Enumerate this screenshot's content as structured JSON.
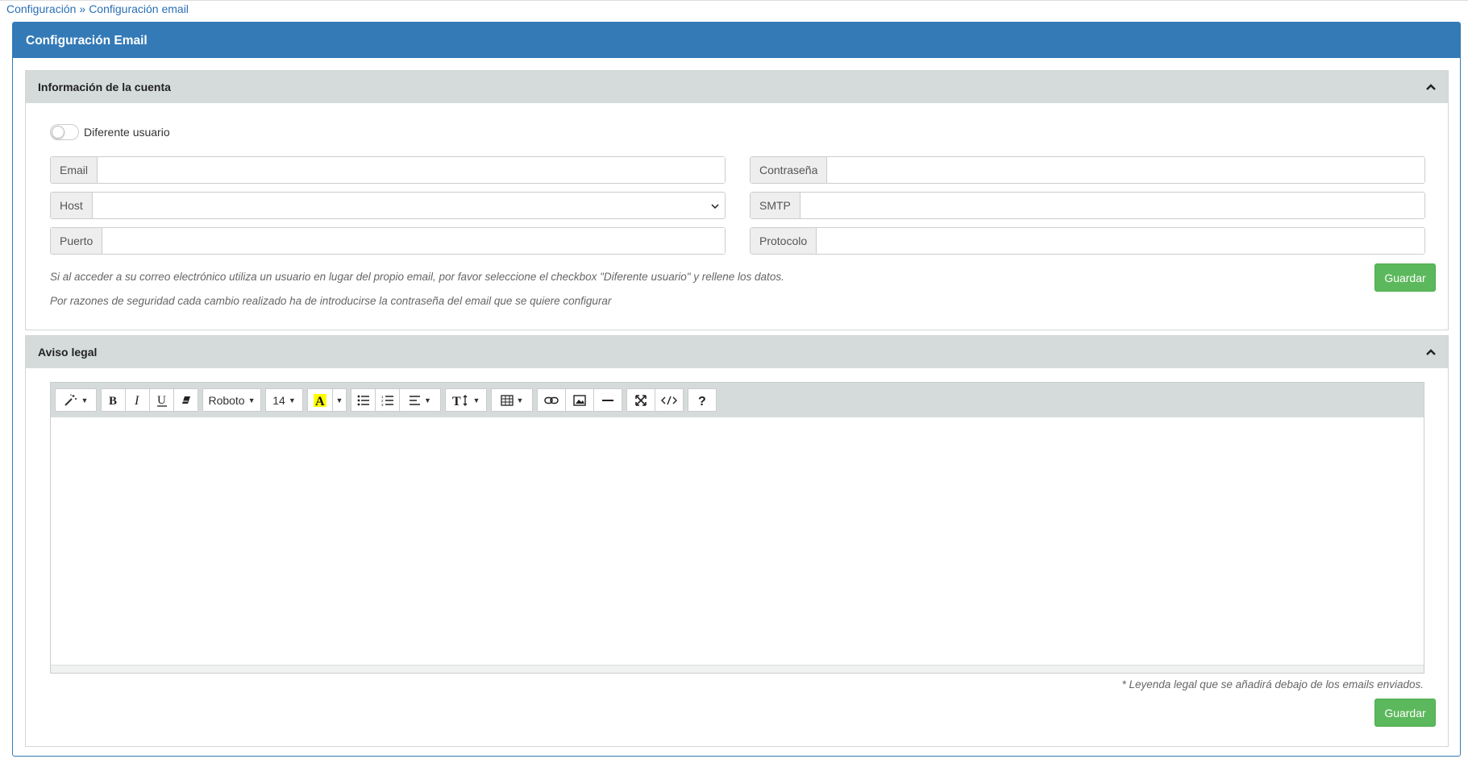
{
  "breadcrumb": {
    "item1": "Configuración",
    "separator": "»",
    "item2": "Configuración email"
  },
  "panel": {
    "title": "Configuración Email"
  },
  "account": {
    "title": "Información de la cuenta",
    "toggle_label": "Diferente usuario",
    "toggle_on": false,
    "fields": {
      "email": {
        "label": "Email",
        "value": ""
      },
      "password": {
        "label": "Contraseña",
        "value": ""
      },
      "host": {
        "label": "Host",
        "value": ""
      },
      "smtp": {
        "label": "SMTP",
        "value": ""
      },
      "port": {
        "label": "Puerto",
        "value": ""
      },
      "protocol": {
        "label": "Protocolo",
        "value": ""
      }
    },
    "note1": "Si al acceder a su correo electrónico utiliza un usuario en lugar del propio email, por favor seleccione el checkbox \"Diferente usuario\" y rellene los datos.",
    "note2": "Por razones de seguridad cada cambio realizado ha de introducirse la contraseña del email que se quiere configurar",
    "save_label": "Guardar"
  },
  "legal": {
    "title": "Aviso legal",
    "toolbar": {
      "font_name": "Roboto",
      "font_size": "14"
    },
    "editor_content": "",
    "footnote": "* Leyenda legal que se añadirá debajo de los emails enviados.",
    "save_label": "Guardar"
  },
  "icons": [
    "chevron-up-icon",
    "magic-wand-icon",
    "bold-icon",
    "italic-icon",
    "underline-icon",
    "eraser-icon",
    "font-color-icon",
    "unordered-list-icon",
    "ordered-list-icon",
    "align-icon",
    "text-height-icon",
    "table-icon",
    "link-icon",
    "image-icon",
    "horizontal-rule-icon",
    "fullscreen-icon",
    "code-view-icon",
    "help-icon"
  ],
  "colors": {
    "primary": "#337ab7",
    "success": "#5cb85c",
    "section_header": "#d5dbdb",
    "highlight": "#ffff00"
  }
}
